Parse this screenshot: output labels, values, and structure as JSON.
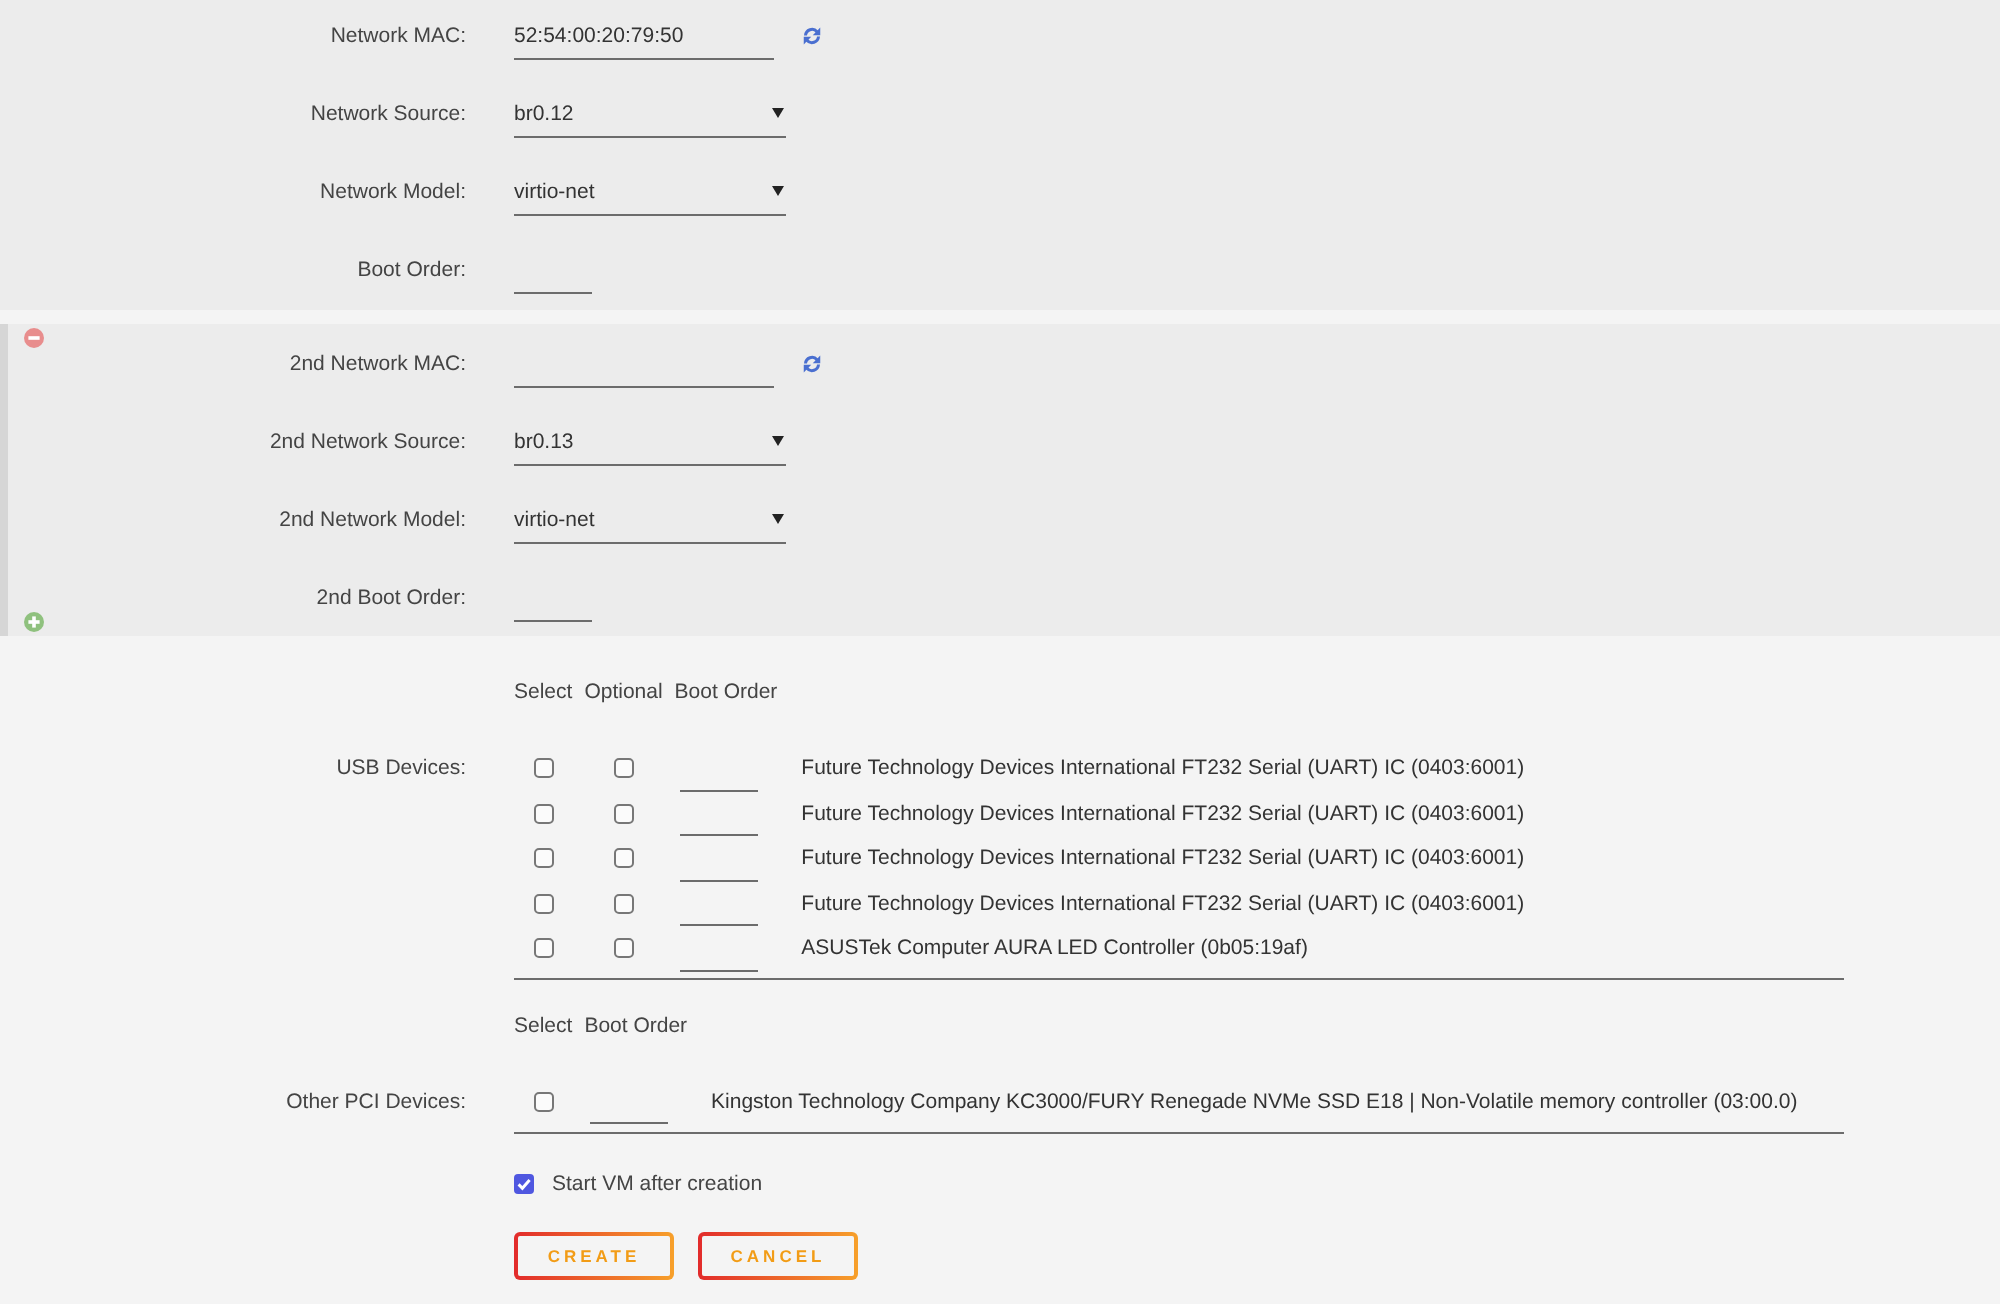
{
  "network_sections": [
    {
      "removable": false,
      "addable": false,
      "fields": [
        {
          "kind": "mac",
          "label": "Network MAC:",
          "value": "52:54:00:20:79:50"
        },
        {
          "kind": "select",
          "label": "Network Source:",
          "value": "br0.12"
        },
        {
          "kind": "select",
          "label": "Network Model:",
          "value": "virtio-net"
        },
        {
          "kind": "order",
          "label": "Boot Order:"
        }
      ]
    },
    {
      "removable": true,
      "addable": true,
      "fields": [
        {
          "kind": "mac",
          "label": "2nd Network MAC:"
        },
        {
          "kind": "select",
          "label": "2nd Network Source:",
          "value": "br0.13"
        },
        {
          "kind": "select",
          "label": "2nd Network Model:",
          "value": "virtio-net"
        },
        {
          "kind": "order",
          "label": "2nd Boot Order:"
        }
      ]
    }
  ],
  "usb": {
    "label": "USB Devices:",
    "columns": [
      {
        "label": "Select",
        "kind": "select"
      },
      {
        "label": "Optional",
        "kind": "optional"
      },
      {
        "label": "Boot Order",
        "kind": "order"
      }
    ],
    "devices": [
      {
        "name": "Future Technology Devices International FT232 Serial (UART) IC (0403:6001)",
        "selected": false,
        "optional": false
      },
      {
        "name": "Future Technology Devices International FT232 Serial (UART) IC (0403:6001)",
        "selected": false,
        "optional": false
      },
      {
        "name": "Future Technology Devices International FT232 Serial (UART) IC (0403:6001)",
        "selected": false,
        "optional": false
      },
      {
        "name": "Future Technology Devices International FT232 Serial (UART) IC (0403:6001)",
        "selected": false,
        "optional": false
      },
      {
        "name": "ASUSTek Computer AURA LED Controller (0b05:19af)",
        "selected": false,
        "optional": false
      }
    ]
  },
  "pci": {
    "label": "Other PCI Devices:",
    "columns": [
      {
        "label": "Select",
        "kind": "select"
      },
      {
        "label": "Boot Order",
        "kind": "order"
      }
    ],
    "devices": [
      {
        "name": "Kingston Technology Company KC3000/FURY Renegade NVMe SSD E18 | Non-Volatile memory controller (03:00.0)",
        "selected": false
      }
    ]
  },
  "start_vm": {
    "label": "Start VM after creation",
    "checked": true
  },
  "buttons": [
    "CREATE",
    "CANCEL"
  ]
}
